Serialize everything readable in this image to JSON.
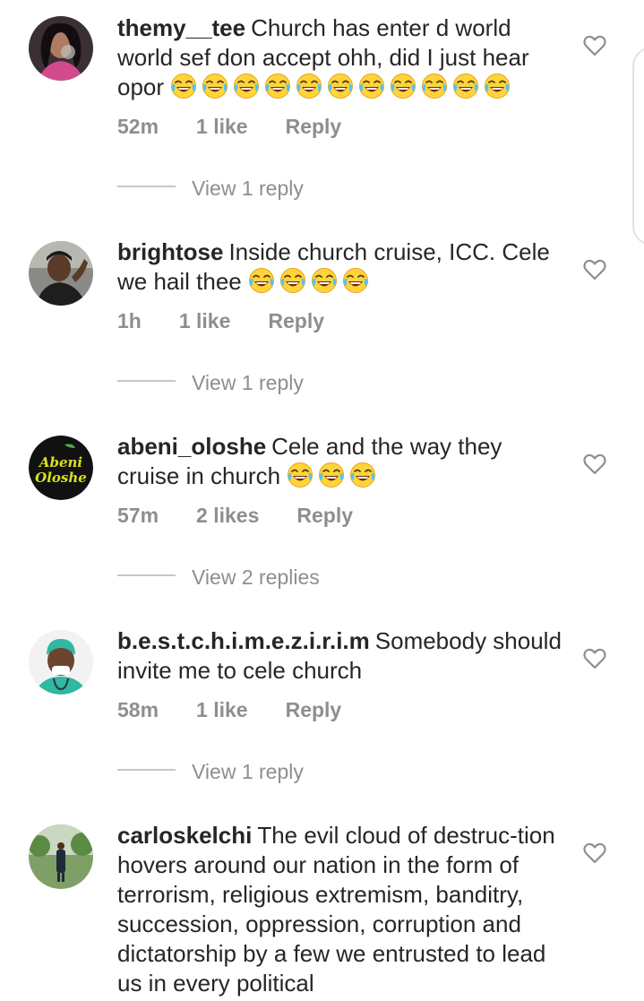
{
  "comments": [
    {
      "username": "themy__tee",
      "text": "Church has enter d world world sef don accept ohh, did I just hear opor",
      "emoji_count": 11,
      "time": "52m",
      "likes": "1 like",
      "reply": "Reply",
      "view_replies": "View 1 reply"
    },
    {
      "username": "brightose",
      "text": "Inside church cruise, ICC. Cele we hail thee",
      "emoji_count": 4,
      "time": "1h",
      "likes": "1 like",
      "reply": "Reply",
      "view_replies": "View 1 reply"
    },
    {
      "username": "abeni_oloshe",
      "text": "Cele and the way they cruise in church",
      "emoji_count": 3,
      "avatar_text_line1": "Abeni",
      "avatar_text_line2": "Oloshe",
      "time": "57m",
      "likes": "2 likes",
      "reply": "Reply",
      "view_replies": "View 2 replies"
    },
    {
      "username": "b.e.s.t.c.h.i.m.e.z.i.r.i.m",
      "text": "Somebody should invite me to cele church",
      "emoji_count": 0,
      "time": "58m",
      "likes": "1 like",
      "reply": "Reply",
      "view_replies": "View 1 reply"
    },
    {
      "username": "carloskelchi",
      "text": "The evil cloud of destruc-tion hovers around our nation in the form of terrorism, religious extremism, banditry, succession, oppression, corruption and dictatorship by a few we entrusted to lead us in every political",
      "emoji_count": 0
    }
  ],
  "icons": {
    "emoji": "face-with-tears-of-joy-icon",
    "like": "heart-outline-icon"
  },
  "colors": {
    "text": "#262626",
    "secondary": "#8e8e8e",
    "divider": "#c7c7c7"
  }
}
